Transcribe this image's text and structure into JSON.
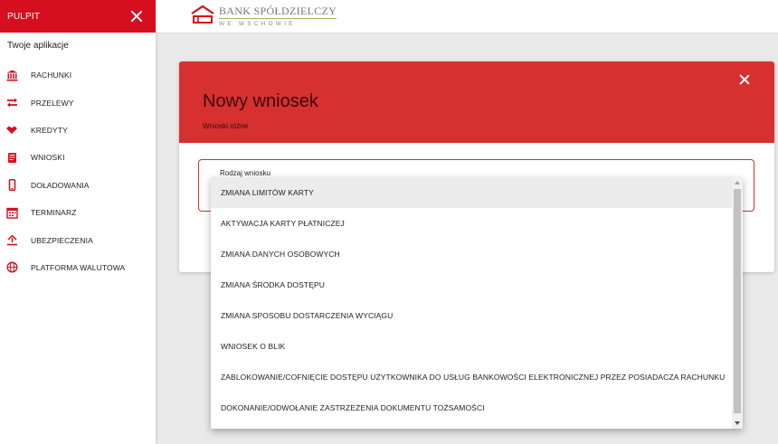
{
  "sidebar": {
    "title": "PULPIT",
    "section_label": "Twoje aplikacje",
    "items": [
      {
        "label": "RACHUNKI",
        "icon": "bank-icon"
      },
      {
        "label": "PRZELEWY",
        "icon": "transfer-icon"
      },
      {
        "label": "KREDYTY",
        "icon": "handshake-icon"
      },
      {
        "label": "WNIOSKI",
        "icon": "document-icon"
      },
      {
        "label": "DOŁADOWANIA",
        "icon": "phone-icon"
      },
      {
        "label": "TERMINARZ",
        "icon": "calendar-icon"
      },
      {
        "label": "UBEZPIECZENIA",
        "icon": "insurance-icon"
      },
      {
        "label": "PLATFORMA WALUTOWA",
        "icon": "globe-icon"
      }
    ]
  },
  "brand": {
    "name": "BANK SPÓŁDZIELCZY",
    "subtitle": "WE WSCHOWIE",
    "primary_color": "#d50f1d",
    "card_header_color": "#d63031"
  },
  "card": {
    "title": "Nowy wniosek",
    "subtitle": "Wnioski różne",
    "field_label": "Rodzaj wniosku"
  },
  "dropdown": {
    "options": [
      "ZMIANA LIMITÓW KARTY",
      "AKTYWACJA KARTY PŁATNICZEJ",
      "ZMIANA DANYCH OSOBOWYCH",
      "ZMIANA ŚRODKA DOSTĘPU",
      "ZMIANA SPOSOBU DOSTARCZENIA WYCIĄGU",
      "WNIOSEK O BLIK",
      "ZABLOKOWANIE/COFNIĘCIE DOSTĘPU UŻYTKOWNIKA DO USŁUG BANKOWOŚCI ELEKTRONICZNEJ PRZEZ POSIADACZA RACHUNKU",
      "DOKONANIE/ODWOŁANIE ZASTRZEŻENIA DOKUMENTU TOŻSAMOŚCI"
    ]
  }
}
